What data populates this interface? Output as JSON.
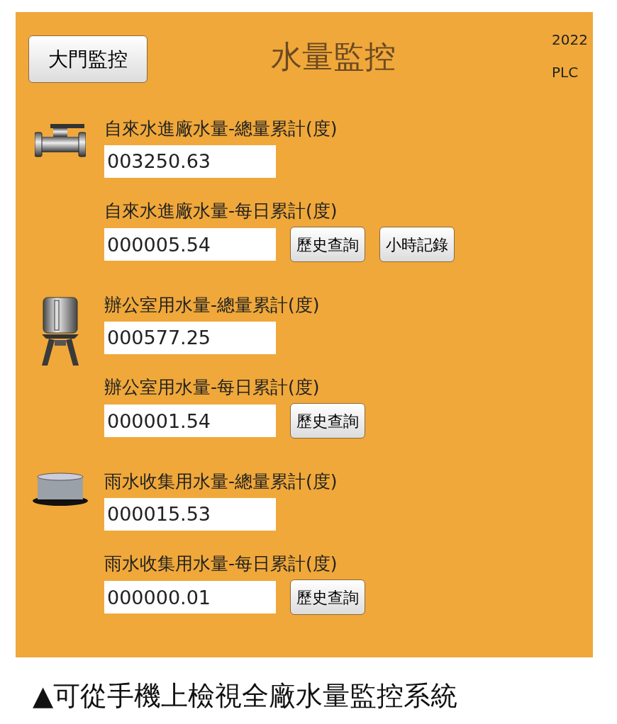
{
  "header": {
    "nav_button": "大門監控",
    "title": "水量監控",
    "corner_lines": [
      "2022",
      "PLC"
    ]
  },
  "sections": [
    {
      "kind": "valve",
      "rows": [
        {
          "label": "自來水進廠水量-總量累計(度)",
          "value": "003250.63",
          "buttons": []
        },
        {
          "label": "自來水進廠水量-每日累計(度)",
          "value": "000005.54",
          "buttons": [
            "歷史查詢",
            "小時記錄"
          ]
        }
      ]
    },
    {
      "kind": "tank",
      "rows": [
        {
          "label": "辦公室用水量-總量累計(度)",
          "value": "000577.25",
          "buttons": []
        },
        {
          "label": "辦公室用水量-每日累計(度)",
          "value": "000001.54",
          "buttons": [
            "歷史查詢"
          ]
        }
      ]
    },
    {
      "kind": "basin",
      "rows": [
        {
          "label": "雨水收集用水量-總量累計(度)",
          "value": "000015.53",
          "buttons": []
        },
        {
          "label": "雨水收集用水量-每日累計(度)",
          "value": "000000.01",
          "buttons": [
            "歷史查詢"
          ]
        }
      ]
    }
  ],
  "caption": "▲可從手機上檢視全廠水量監控系統"
}
